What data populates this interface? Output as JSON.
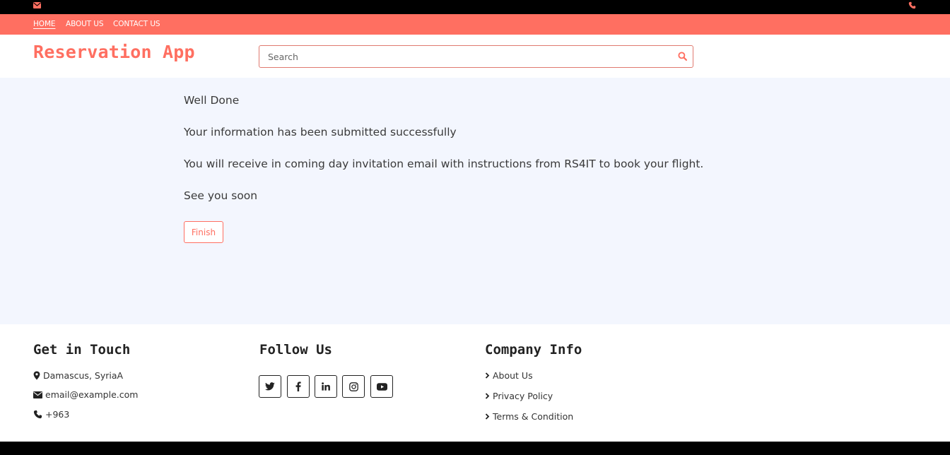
{
  "nav": {
    "items": [
      {
        "label": "HOME"
      },
      {
        "label": "ABOUT US"
      },
      {
        "label": "CONTACT US"
      }
    ]
  },
  "header": {
    "brand": "Reservation App",
    "search_placeholder": "Search"
  },
  "main": {
    "lines": [
      "Well Done",
      "Your information has been submitted successfully",
      "You will receive in coming day invitation email with instructions from RS4IT to book your flight.",
      "See you soon"
    ],
    "finish_label": "Finish"
  },
  "footer": {
    "get_in_touch": {
      "title": "Get in Touch",
      "address": "Damascus, SyriaA",
      "email": "email@example.com",
      "phone": "+963"
    },
    "follow_us": {
      "title": "Follow Us",
      "icons": [
        "twitter-icon",
        "facebook-icon",
        "linkedin-icon",
        "instagram-icon",
        "youtube-icon"
      ]
    },
    "company_info": {
      "title": "Company Info",
      "links": [
        "About Us",
        "Privacy Policy",
        "Terms & Condition"
      ]
    }
  },
  "colors": {
    "accent": "#ff6f61",
    "main_bg": "#f3f6fe",
    "topbar": "#000000"
  }
}
